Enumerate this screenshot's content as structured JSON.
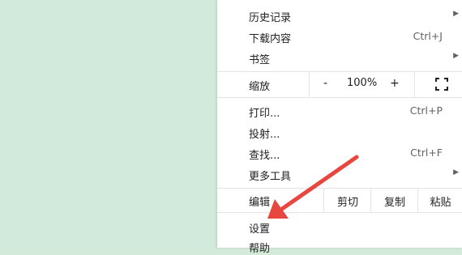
{
  "menu": {
    "history": "历史记录",
    "downloads": "下载内容",
    "downloads_shortcut": "Ctrl+J",
    "bookmarks": "书签",
    "zoom": {
      "label": "缩放",
      "minus": "-",
      "value": "100%",
      "plus": "+"
    },
    "print": "打印...",
    "print_shortcut": "Ctrl+P",
    "cast": "投射...",
    "find": "查找...",
    "find_shortcut": "Ctrl+F",
    "more_tools": "更多工具",
    "edit": {
      "label": "编辑",
      "cut": "剪切",
      "copy": "复制",
      "paste": "粘贴"
    },
    "settings": "设置",
    "help": "帮助"
  },
  "submenu_arrow": "▶",
  "colors": {
    "annotation_arrow": "#e8473f",
    "page_background": "#d4ead9"
  },
  "icons": [
    "fullscreen-icon",
    "annotation-arrow"
  ]
}
